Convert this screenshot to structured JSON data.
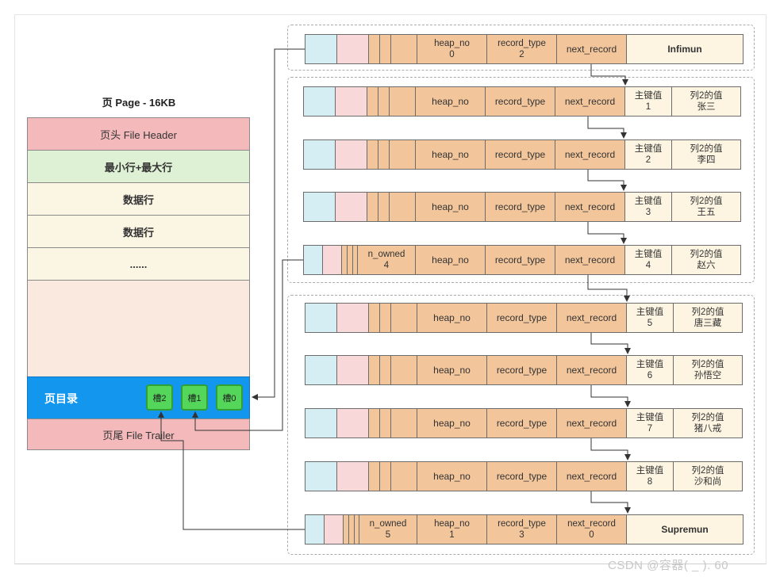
{
  "page": {
    "title": "页 Page - 16KB",
    "sections": [
      {
        "label": "页头 File Header"
      },
      {
        "label": "最小行+最大行"
      },
      {
        "label": "数据行"
      },
      {
        "label": "数据行"
      },
      {
        "label": "......"
      },
      {
        "label": ""
      },
      {
        "label": "页目录"
      },
      {
        "label": "页尾 File Trailer"
      }
    ],
    "slots": [
      "槽2",
      "槽1",
      "槽0"
    ]
  },
  "fields": {
    "heap_no": "heap_no",
    "record_type": "record_type",
    "next_record": "next_record",
    "n_owned": "n_owned",
    "pk": "主键值",
    "col2": "列2的值"
  },
  "infimum": {
    "heap_no": "0",
    "record_type": "2",
    "name": "Infimun"
  },
  "supremum": {
    "n_owned": "5",
    "heap_no": "1",
    "record_type": "3",
    "next_record": "0",
    "name": "Supremun"
  },
  "records": [
    {
      "pk": "1",
      "col2": "张三"
    },
    {
      "pk": "2",
      "col2": "李四"
    },
    {
      "pk": "3",
      "col2": "王五"
    },
    {
      "pk": "4",
      "col2": "赵六",
      "n_owned": "4"
    },
    {
      "pk": "5",
      "col2": "唐三藏"
    },
    {
      "pk": "6",
      "col2": "孙悟空"
    },
    {
      "pk": "7",
      "col2": "猪八戒"
    },
    {
      "pk": "8",
      "col2": "沙和尚"
    }
  ],
  "watermark": "CSDN @容器(   _   ). 60",
  "colors": {
    "header_pink": "#f4b9bb",
    "minmax_green": "#dff1d4",
    "data_cream": "#fbf6e4",
    "free_space": "#f9e9de",
    "directory_blue": "#1296ee",
    "slot_green": "#53d65a",
    "field_orange": "#f2c59b",
    "cyan": "#d5eef3",
    "pink": "#f8d8d9"
  }
}
